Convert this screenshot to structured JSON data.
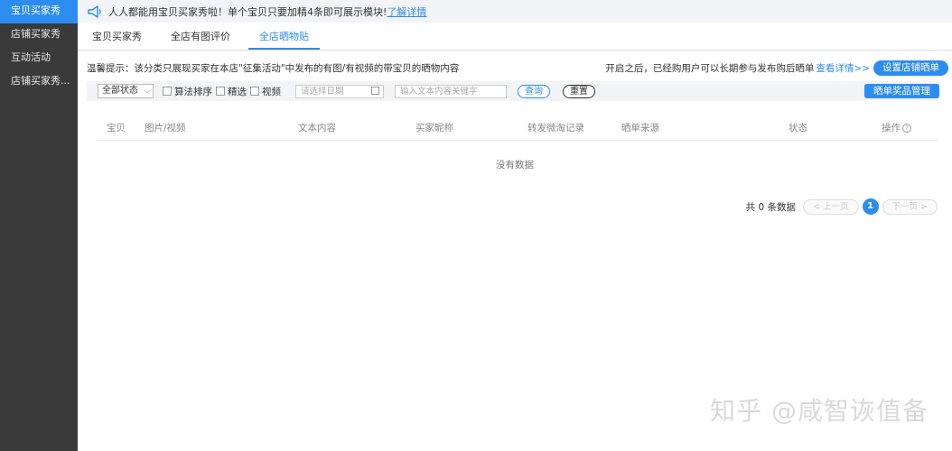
{
  "sidebar": {
    "items": [
      {
        "label": "宝贝买家秀"
      },
      {
        "label": "店铺买家秀"
      },
      {
        "label": "互动活动"
      },
      {
        "label": "店铺买家秀..."
      }
    ]
  },
  "notice": {
    "icon": "megaphone-icon",
    "text": "人人都能用宝贝买家秀啦！单个宝贝只要加精4条即可展示模块!",
    "link": "了解详情"
  },
  "tabs": [
    {
      "label": "宝贝买家秀"
    },
    {
      "label": "全店有图评价"
    },
    {
      "label": "全店晒物贴"
    }
  ],
  "tip": {
    "left": "温馨提示：该分类只展现买家在本店\"征集活动\"中发布的有图/有视频的带宝贝的晒物内容",
    "right_text": "开启之后，已经购用户可以长期参与发布购后晒单",
    "right_link": "查看详情>>",
    "setup_button": "设置店铺晒单"
  },
  "filters": {
    "status_select": "全部状态",
    "checkboxes": [
      {
        "label": "算法排序"
      },
      {
        "label": "精选"
      },
      {
        "label": "视频"
      }
    ],
    "date_placeholder": "请选择日期",
    "text_placeholder": "输入文本内容关键字",
    "query_button": "查询",
    "reset_button": "重置",
    "prize_button": "晒单奖品管理"
  },
  "table": {
    "columns": [
      "宝贝",
      "图片/视频",
      "文本内容",
      "买家昵称",
      "转发微淘记录",
      "晒单来源",
      "状态",
      "操作"
    ],
    "help_glyph": "?",
    "empty_text": "没有数据"
  },
  "pagination": {
    "total": "共 0 条数据",
    "prev": "< 上一页",
    "current": "1",
    "next": "下一页 >"
  },
  "watermark": "知乎 @咸智诙值备",
  "colors": {
    "accent": "#2d8cf0",
    "sidebar_bg": "#3a3a3a"
  }
}
